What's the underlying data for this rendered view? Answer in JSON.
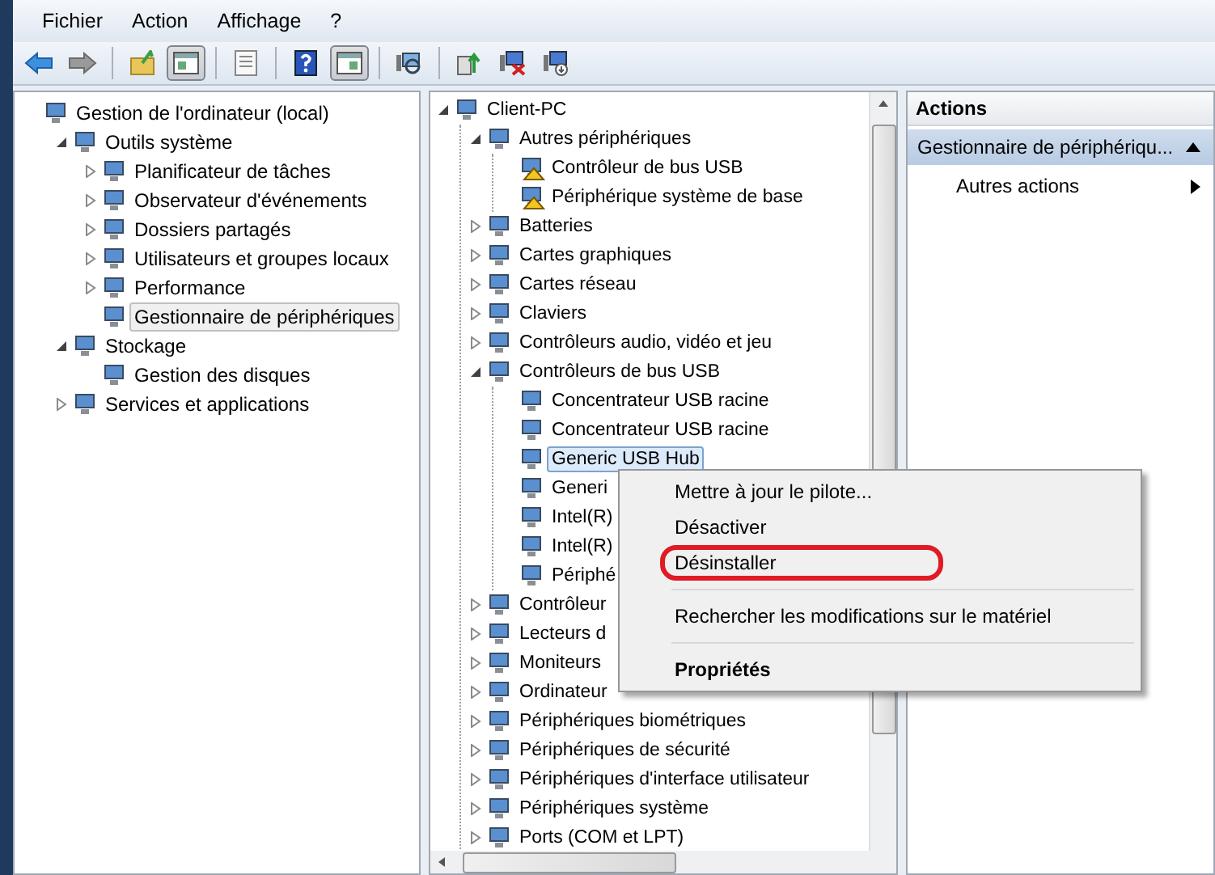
{
  "menubar": [
    "Fichier",
    "Action",
    "Affichage",
    "?"
  ],
  "toolbar": [
    {
      "kind": "back",
      "pressed": false
    },
    {
      "kind": "forward",
      "pressed": false
    },
    {
      "kind": "separator"
    },
    {
      "kind": "up",
      "pressed": false
    },
    {
      "kind": "tree",
      "pressed": true
    },
    {
      "kind": "separator"
    },
    {
      "kind": "export",
      "pressed": false
    },
    {
      "kind": "separator"
    },
    {
      "kind": "help",
      "pressed": false
    },
    {
      "kind": "actionpane",
      "pressed": true
    },
    {
      "kind": "separator"
    },
    {
      "kind": "scan",
      "pressed": false
    },
    {
      "kind": "separator"
    },
    {
      "kind": "update",
      "pressed": false
    },
    {
      "kind": "uninstall",
      "pressed": false
    },
    {
      "kind": "disable",
      "pressed": false
    }
  ],
  "left_tree": {
    "items": [
      {
        "label": "Gestion de l'ordinateur (local)",
        "selected": false,
        "children": [
          {
            "label": "Outils système",
            "selected": false,
            "expanded": true,
            "children": [
              {
                "label": "Planificateur de tâches",
                "selected": false,
                "expanded": false
              },
              {
                "label": "Observateur d'événements",
                "selected": false,
                "expanded": false
              },
              {
                "label": "Dossiers partagés",
                "selected": false,
                "expanded": false
              },
              {
                "label": "Utilisateurs et groupes locaux",
                "selected": false,
                "expanded": false
              },
              {
                "label": "Performance",
                "selected": false,
                "expanded": false
              },
              {
                "label": "Gestionnaire de périphériques",
                "selected": true
              }
            ]
          },
          {
            "label": "Stockage",
            "selected": false,
            "expanded": true,
            "children": [
              {
                "label": "Gestion des disques",
                "selected": false
              }
            ]
          },
          {
            "label": "Services et applications",
            "selected": false,
            "expanded": false
          }
        ]
      }
    ]
  },
  "device_tree": {
    "items": [
      {
        "label": "Client-PC",
        "selected": false,
        "expanded": true,
        "children": [
          {
            "label": "Autres périphériques",
            "selected": false,
            "expanded": true,
            "children": [
              {
                "label": "Contrôleur de bus USB",
                "selected": false,
                "warning": true
              },
              {
                "label": "Périphérique système de base",
                "selected": false,
                "warning": true
              }
            ]
          },
          {
            "label": "Batteries",
            "selected": false,
            "expanded": false
          },
          {
            "label": "Cartes graphiques",
            "selected": false,
            "expanded": false
          },
          {
            "label": "Cartes réseau",
            "selected": false,
            "expanded": false
          },
          {
            "label": "Claviers",
            "selected": false,
            "expanded": false
          },
          {
            "label": "Contrôleurs audio, vidéo et jeu",
            "selected": false,
            "expanded": false
          },
          {
            "label": "Contrôleurs de bus USB",
            "selected": false,
            "expanded": true,
            "children": [
              {
                "label": "Concentrateur USB racine",
                "selected": false
              },
              {
                "label": "Concentrateur USB racine",
                "selected": false
              },
              {
                "label": "Generic USB Hub",
                "selected": true
              },
              {
                "label": "Generi",
                "selected": false
              },
              {
                "label": "Intel(R)",
                "selected": false
              },
              {
                "label": "Intel(R)",
                "selected": false
              },
              {
                "label": "Périphé",
                "selected": false
              }
            ]
          },
          {
            "label": "Contrôleur",
            "selected": false,
            "expanded": false
          },
          {
            "label": "Lecteurs d",
            "selected": false,
            "expanded": false
          },
          {
            "label": "Moniteurs",
            "selected": false,
            "expanded": false
          },
          {
            "label": "Ordinateur",
            "selected": false,
            "expanded": false
          },
          {
            "label": "Périphériques biométriques",
            "selected": false,
            "expanded": false
          },
          {
            "label": "Périphériques de sécurité",
            "selected": false,
            "expanded": false
          },
          {
            "label": "Périphériques d'interface utilisateur",
            "selected": false,
            "expanded": false
          },
          {
            "label": "Périphériques système",
            "selected": false,
            "expanded": false
          },
          {
            "label": "Ports (COM et LPT)",
            "selected": false,
            "expanded": false
          }
        ]
      }
    ]
  },
  "context_menu": [
    {
      "kind": "item",
      "label": "Mettre à jour le pilote...",
      "highlighted": false,
      "default": false
    },
    {
      "kind": "item",
      "label": "Désactiver",
      "highlighted": false,
      "default": false
    },
    {
      "kind": "item",
      "label": "Désinstaller",
      "highlighted": true,
      "default": false
    },
    {
      "kind": "separator"
    },
    {
      "kind": "item",
      "label": "Rechercher les modifications sur le matériel",
      "highlighted": false,
      "default": false
    },
    {
      "kind": "separator"
    },
    {
      "kind": "item",
      "label": "Propriétés",
      "highlighted": false,
      "default": true
    }
  ],
  "actions_pane": {
    "title": "Actions",
    "items": [
      {
        "kind": "section",
        "label": "Gestionnaire de périphériqu...",
        "selected": true
      },
      {
        "kind": "submenu",
        "label": "Autres actions",
        "selected": false
      }
    ]
  }
}
